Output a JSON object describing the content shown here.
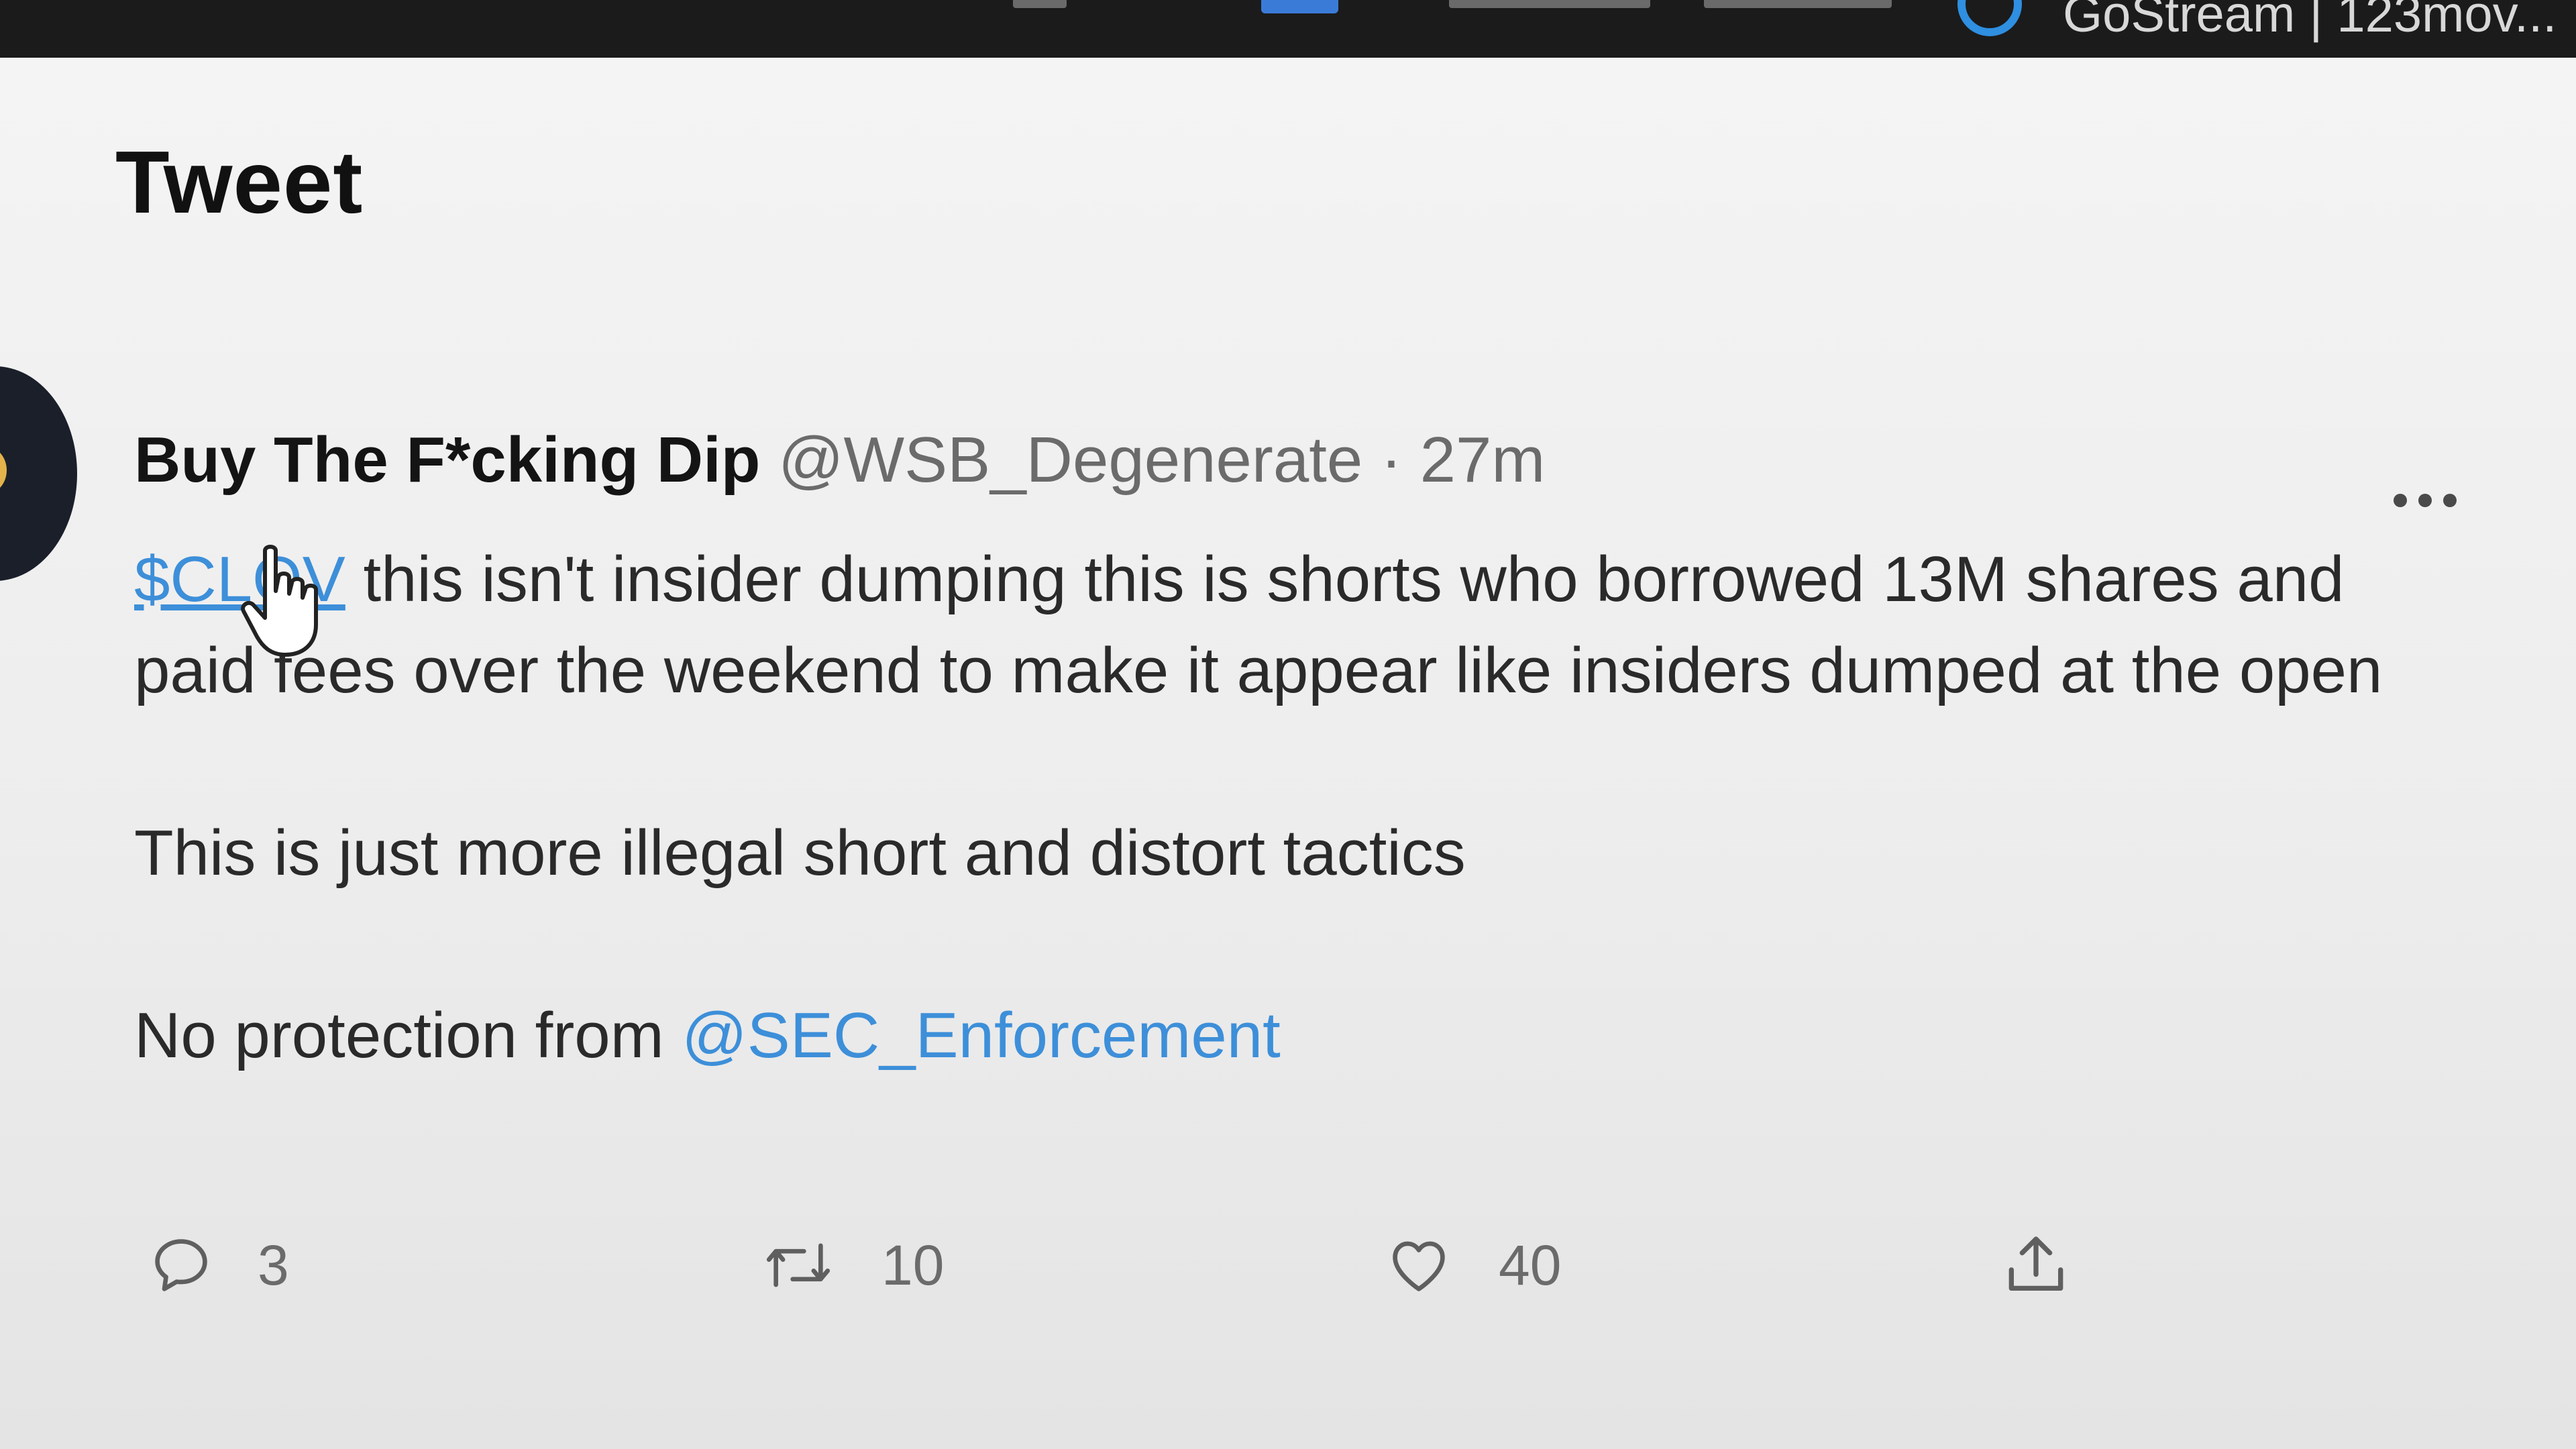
{
  "browser": {
    "tab_text": "GoStream | 123mov..."
  },
  "page": {
    "title": "Tweet"
  },
  "tweet": {
    "author_name": "Buy The F*cking Dip",
    "handle": "@WSB_Degenerate",
    "separator": "·",
    "time": "27m",
    "cashtag": "$CLOV",
    "line1": " this isn't insider dumping this is shorts who borrowed 13M shares and paid fees over the weekend to make it appear like insiders dumped at the open",
    "line2": "This is just more illegal short and distort tactics",
    "line3_prefix": "No protection from ",
    "mention": "@SEC_Enforcement"
  },
  "actions": {
    "replies": "3",
    "retweets": "10",
    "likes": "40"
  },
  "colors": {
    "accent": "#3d8fd9",
    "muted": "#6b6b6b",
    "topbar": "#1b1b1b"
  },
  "icons": [
    "more-icon",
    "reply-icon",
    "retweet-icon",
    "like-icon",
    "share-icon",
    "hand-cursor-icon",
    "browser-tab-icon"
  ]
}
